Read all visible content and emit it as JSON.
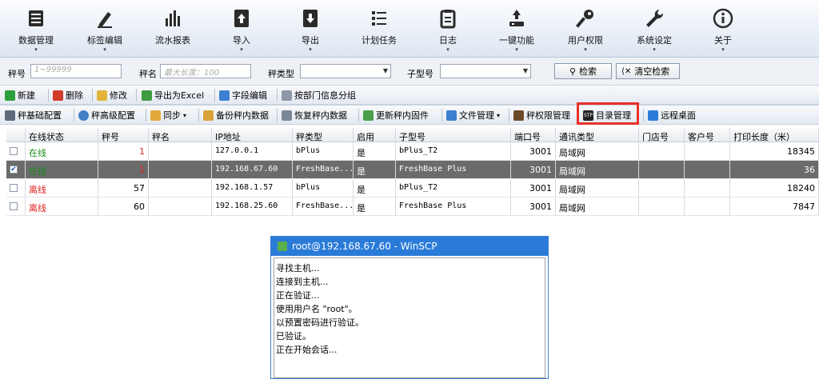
{
  "ribbon": [
    {
      "label": "数据管理",
      "icon": "database-icon",
      "caret": "▾"
    },
    {
      "label": "标签编辑",
      "icon": "pen-edit-icon",
      "caret": "▾"
    },
    {
      "label": "流水报表",
      "icon": "bar-chart-icon",
      "caret": ""
    },
    {
      "label": "导入",
      "icon": "import-icon",
      "caret": "▾"
    },
    {
      "label": "导出",
      "icon": "export-icon",
      "caret": "▾"
    },
    {
      "label": "计划任务",
      "icon": "task-list-icon",
      "caret": ""
    },
    {
      "label": "日志",
      "icon": "log-icon",
      "caret": "▾"
    },
    {
      "label": "一键功能",
      "icon": "one-click-icon",
      "caret": "▾"
    },
    {
      "label": "用户权限",
      "icon": "key-icon",
      "caret": "▾"
    },
    {
      "label": "系统设定",
      "icon": "wrench-icon",
      "caret": "▾"
    },
    {
      "label": "关于",
      "icon": "info-icon",
      "caret": "▾"
    }
  ],
  "filters": {
    "scale_no_label": "秤号",
    "scale_no_placeholder": "1~99999",
    "scale_name_label": "秤名",
    "scale_name_placeholder": "最大长度：100",
    "scale_type_label": "秤类型",
    "subtype_label": "子型号",
    "search_label": "检索",
    "clear_label": "清空检索"
  },
  "toolbar1": {
    "new": "新建",
    "delete": "删除",
    "modify": "修改",
    "export_excel": "导出为Excel",
    "field_edit": "字段编辑",
    "group_by_dept": "按部门信息分组"
  },
  "toolbar2": {
    "basic_config": "秤基础配置",
    "advanced_config": "秤高级配置",
    "sync": "同步",
    "backup": "备份秤内数据",
    "restore": "恢复秤内数据",
    "update_firmware": "更新秤内固件",
    "file_manage": "文件管理",
    "permission": "秤权限管理",
    "dir_manage": "目录管理",
    "remote_desktop": "远程桌面"
  },
  "table": {
    "headers": [
      "在线状态",
      "秤号",
      "秤名",
      "IP地址",
      "秤类型",
      "启用",
      "子型号",
      "端口号",
      "通讯类型",
      "门店号",
      "客户号",
      "打印长度（米）"
    ],
    "rows": [
      {
        "checked": "",
        "status": "在线",
        "status_color": "#1a8c1a",
        "no": "1",
        "name": "",
        "ip": "127.0.0.1",
        "type": "bPlus",
        "enabled": "是",
        "subtype": "bPlus_T2",
        "port": "3001",
        "comm": "局域网",
        "store": "",
        "customer": "",
        "print_len": "18345",
        "selected": false
      },
      {
        "checked": "✔",
        "status": "在线",
        "status_color": "#1a8c1a",
        "no": "1",
        "name": "",
        "ip": "192.168.67.60",
        "type": "FreshBase...",
        "enabled": "是",
        "subtype": "FreshBase Plus",
        "port": "3001",
        "comm": "局域网",
        "store": "",
        "customer": "",
        "print_len": "36",
        "selected": true
      },
      {
        "checked": "",
        "status": "离线",
        "status_color": "#e02020",
        "no": "57",
        "name": "",
        "ip": "192.168.1.57",
        "type": "bPlus",
        "enabled": "是",
        "subtype": "bPlus_T2",
        "port": "3001",
        "comm": "局域网",
        "store": "",
        "customer": "",
        "print_len": "18240",
        "selected": false
      },
      {
        "checked": "",
        "status": "离线",
        "status_color": "#e02020",
        "no": "60",
        "name": "",
        "ip": "192.168.25.60",
        "type": "FreshBase...",
        "enabled": "是",
        "subtype": "FreshBase Plus",
        "port": "3001",
        "comm": "局域网",
        "store": "",
        "customer": "",
        "print_len": "7847",
        "selected": false
      }
    ]
  },
  "dialog": {
    "title": "root@192.168.67.60 - WinSCP",
    "lines": [
      "寻找主机...",
      "连接到主机...",
      "正在验证...",
      "使用用户名 \"root\"。",
      "以预置密码进行验证。",
      "已验证。",
      "正在开始会话..."
    ]
  },
  "colors": {
    "highlight": "#e8312a",
    "titlebar": "#2a7bd8",
    "online": "#1a8c1a",
    "offline": "#e02020"
  }
}
